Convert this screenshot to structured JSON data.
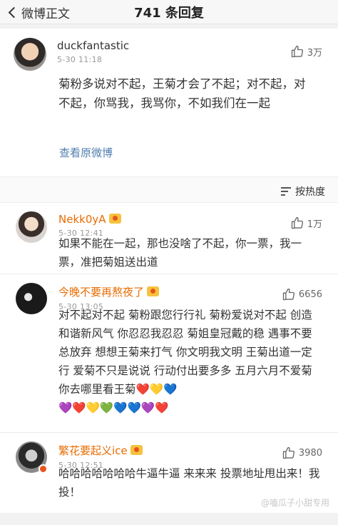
{
  "header": {
    "back_label": "微博正文",
    "title": "741 条回复"
  },
  "post": {
    "username": "duckfantastic",
    "time": "5-30 11:18",
    "likes": "3万",
    "text": "菊粉多说对不起，王菊才会了不起；对不起，对不起，你骂我，我骂你，不如我们在一起",
    "view_original": "查看原微博"
  },
  "sort": {
    "label": "按热度"
  },
  "comments": [
    {
      "username": "Nekk0yA",
      "time": "5-30 12:41",
      "likes": "1万",
      "text": "如果不能在一起，那也没啥了不起，你一票，我一票，准把菊姐送出道"
    },
    {
      "username": "今晚不要再熬夜了",
      "time": "5-30 13:05",
      "likes": "6656",
      "text": "对不起对不起 菊粉跟您行行礼 菊粉爱说对不起 创造和谐新风气 你忍忍我忍忍 菊姐皇冠戴的稳 遇事不要总放弃 想想王菊来打气 你文明我文明 王菊出道一定行 爱菊不只是说说 行动付出要多多 五月六月不爱菊 你去哪里看王菊❤️💛💙",
      "emoji_line": "💜❤️💛💚💙💙💜❤️"
    },
    {
      "username": "繁花要起义ice",
      "time": "5-30 12:51",
      "likes": "3980",
      "text": "哈哈哈哈哈哈哈牛逼牛逼 来来来 投票地址甩出来！我投！"
    }
  ],
  "watermark": "@嗑瓜子小甜专用",
  "colors": {
    "link": "#507daf",
    "orange_name": "#e86b00",
    "muted": "#999999"
  }
}
